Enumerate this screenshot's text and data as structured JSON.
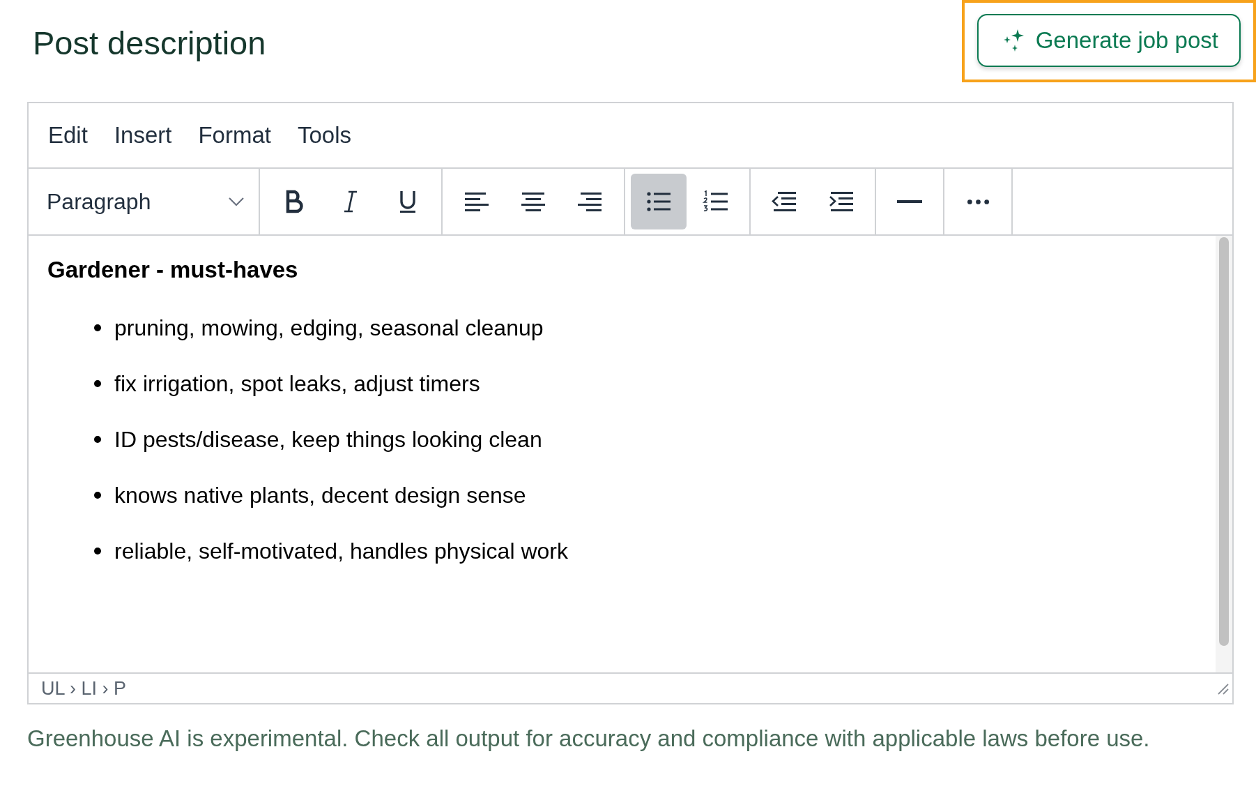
{
  "title": "Post description",
  "generate_button": {
    "label": "Generate job post",
    "highlighted": true
  },
  "editor": {
    "menu": [
      "Edit",
      "Insert",
      "Format",
      "Tools"
    ],
    "block_format": {
      "value": "Paragraph"
    },
    "toolbar_groups": [
      [
        {
          "kind": "bold",
          "pressed": false
        },
        {
          "kind": "italic",
          "pressed": false
        },
        {
          "kind": "underline",
          "pressed": false
        }
      ],
      [
        {
          "kind": "align-left",
          "pressed": false
        },
        {
          "kind": "align-center",
          "pressed": false
        },
        {
          "kind": "align-right",
          "pressed": false
        }
      ],
      [
        {
          "kind": "bullet-list",
          "pressed": true
        },
        {
          "kind": "numbered-list",
          "pressed": false
        }
      ],
      [
        {
          "kind": "outdent",
          "pressed": false
        },
        {
          "kind": "indent",
          "pressed": false
        }
      ],
      [
        {
          "kind": "horizontal-rule",
          "pressed": false
        }
      ],
      [
        {
          "kind": "more",
          "pressed": false
        }
      ]
    ],
    "heading": "Gardener - must-haves",
    "bullets": [
      "pruning, mowing, edging, seasonal cleanup",
      "fix irrigation, spot leaks, adjust timers",
      "ID pests/disease, keep things looking clean",
      "knows native plants, decent design sense",
      "reliable, self-motivated, handles physical work"
    ],
    "status_path": "UL › LI › P"
  },
  "disclaimer": "Greenhouse AI is experimental. Check all output for accuracy and compliance with applicable laws before use."
}
